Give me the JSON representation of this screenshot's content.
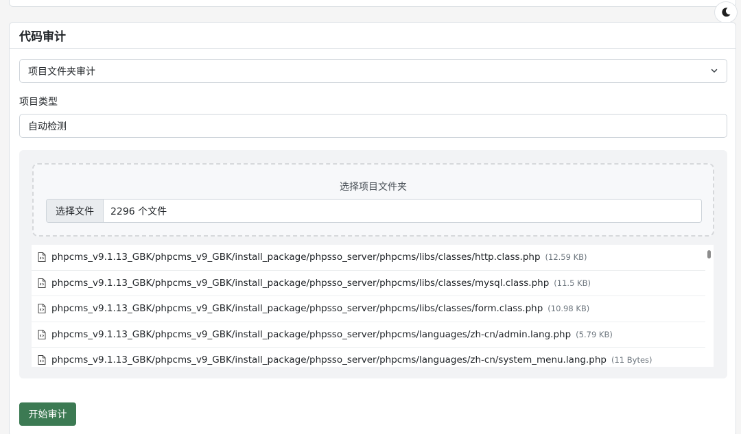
{
  "card": {
    "title": "代码审计"
  },
  "audit_mode": {
    "selected": "项目文件夹审计"
  },
  "project_type": {
    "label": "项目类型",
    "value": "自动检测"
  },
  "upload": {
    "title": "选择项目文件夹",
    "button_label": "选择文件",
    "status": "2296 个文件"
  },
  "files": [
    {
      "path": "phpcms_v9.1.13_GBK/phpcms_v9_GBK/install_package/phpsso_server/phpcms/libs/classes/http.class.php",
      "size": "(12.59 KB)"
    },
    {
      "path": "phpcms_v9.1.13_GBK/phpcms_v9_GBK/install_package/phpsso_server/phpcms/libs/classes/mysql.class.php",
      "size": "(11.5 KB)"
    },
    {
      "path": "phpcms_v9.1.13_GBK/phpcms_v9_GBK/install_package/phpsso_server/phpcms/libs/classes/form.class.php",
      "size": "(10.98 KB)"
    },
    {
      "path": "phpcms_v9.1.13_GBK/phpcms_v9_GBK/install_package/phpsso_server/phpcms/languages/zh-cn/admin.lang.php",
      "size": "(5.79 KB)"
    },
    {
      "path": "phpcms_v9.1.13_GBK/phpcms_v9_GBK/install_package/phpsso_server/phpcms/languages/zh-cn/system_menu.lang.php",
      "size": "(11 Bytes)"
    }
  ],
  "actions": {
    "start_label": "开始审计"
  },
  "icons": {
    "theme": "moon-icon",
    "file": "file-code-icon",
    "select": "chevron-down-icon"
  },
  "colors": {
    "primary_button": "#3c7a53"
  }
}
